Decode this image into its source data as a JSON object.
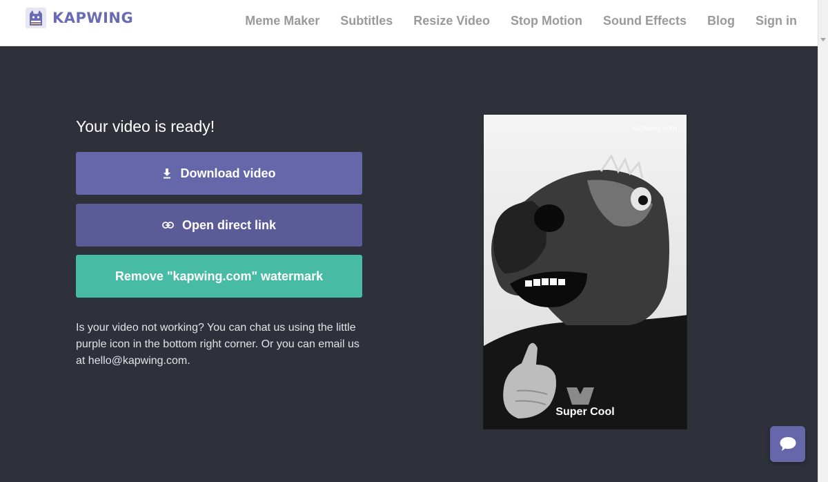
{
  "brand": {
    "name": "KAPWING",
    "logo_icon": "cat-icon",
    "color": "#6b6bb5"
  },
  "nav": {
    "items": [
      {
        "label": "Meme Maker"
      },
      {
        "label": "Subtitles"
      },
      {
        "label": "Resize Video"
      },
      {
        "label": "Stop Motion"
      },
      {
        "label": "Sound Effects"
      },
      {
        "label": "Blog"
      },
      {
        "label": "Sign in"
      }
    ]
  },
  "main": {
    "title": "Your video is ready!",
    "download_label": "Download video",
    "download_icon": "download-icon",
    "link_label": "Open direct link",
    "link_icon": "link-icon",
    "watermark_label": "Remove \"kapwing.com\" watermark",
    "help_text": "Is your video not working? You can chat us using the little purple icon in the bottom right corner. Or you can email us at hello@kapwing.com."
  },
  "video": {
    "watermark": "kapwing.com",
    "caption": "Super Cool"
  },
  "colors": {
    "background": "#2e313a",
    "primary": "#6667ab",
    "secondary": "#5a5b97",
    "accent": "#47bba4"
  },
  "chat": {
    "icon": "chat-icon"
  }
}
